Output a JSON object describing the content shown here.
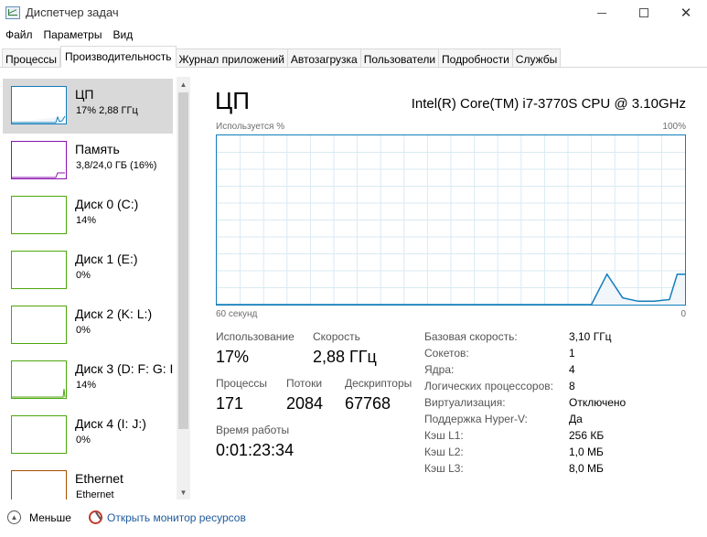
{
  "window": {
    "title": "Диспетчер задач",
    "close_glyph": "✕"
  },
  "menu": [
    "Файл",
    "Параметры",
    "Вид"
  ],
  "tabs": [
    {
      "label": "Процессы",
      "active": false
    },
    {
      "label": "Производительность",
      "active": true
    },
    {
      "label": "Журнал приложений",
      "active": false
    },
    {
      "label": "Автозагрузка",
      "active": false
    },
    {
      "label": "Пользователи",
      "active": false
    },
    {
      "label": "Подробности",
      "active": false
    },
    {
      "label": "Службы",
      "active": false
    }
  ],
  "sidebar": {
    "items": [
      {
        "title": "ЦП",
        "sub": "17% 2,88 ГГц",
        "color": "#117dbb",
        "selected": true,
        "icon": "cpu-graph-thumbnail"
      },
      {
        "title": "Память",
        "sub": "3,8/24,0 ГБ (16%)",
        "color": "#8b12ae",
        "selected": false,
        "icon": "memory-graph-thumbnail"
      },
      {
        "title": "Диск 0 (C:)",
        "sub": "14%",
        "color": "#4da60c",
        "selected": false,
        "icon": "disk-graph-thumbnail"
      },
      {
        "title": "Диск 1 (E:)",
        "sub": "0%",
        "color": "#4da60c",
        "selected": false,
        "icon": "disk-graph-thumbnail"
      },
      {
        "title": "Диск 2 (K: L:)",
        "sub": "0%",
        "color": "#4da60c",
        "selected": false,
        "icon": "disk-graph-thumbnail"
      },
      {
        "title": "Диск 3 (D: F: G: I",
        "sub": "14%",
        "color": "#4da60c",
        "selected": false,
        "icon": "disk-graph-thumbnail"
      },
      {
        "title": "Диск 4 (I: J:)",
        "sub": "0%",
        "color": "#4da60c",
        "selected": false,
        "icon": "disk-graph-thumbnail"
      },
      {
        "title": "Ethernet",
        "sub": "Ethernet",
        "color": "#a74f01",
        "selected": false,
        "icon": "network-graph-thumbnail"
      }
    ],
    "scroll_up": "▲",
    "scroll_down": "▼"
  },
  "main": {
    "title": "ЦП",
    "cpu_name": "Intel(R) Core(TM) i7-3770S CPU @ 3.10GHz",
    "graph_label_left": "Используется %",
    "graph_label_right": "100%",
    "axis_left": "60 секунд",
    "axis_right": "0",
    "graph_color": "#117dbb",
    "graph_fill": "#f1f6fa",
    "stats": {
      "usage_label": "Использование",
      "usage_value": "17%",
      "speed_label": "Скорость",
      "speed_value": "2,88 ГГц",
      "processes_label": "Процессы",
      "processes_value": "171",
      "threads_label": "Потоки",
      "threads_value": "2084",
      "handles_label": "Дескрипторы",
      "handles_value": "67768",
      "uptime_label": "Время работы",
      "uptime_value": "0:01:23:34"
    },
    "info": [
      {
        "label": "Базовая скорость:",
        "value": "3,10 ГГц"
      },
      {
        "label": "Сокетов:",
        "value": "1"
      },
      {
        "label": "Ядра:",
        "value": "4"
      },
      {
        "label": "Логических процессоров:",
        "value": "8"
      },
      {
        "label": "Виртуализация:",
        "value": "Отключено"
      },
      {
        "label": "Поддержка Hyper-V:",
        "value": "Да"
      },
      {
        "label": "Кэш L1:",
        "value": "256 КБ"
      },
      {
        "label": "Кэш L2:",
        "value": "1,0 МБ"
      },
      {
        "label": "Кэш L3:",
        "value": "8,0 МБ"
      }
    ]
  },
  "chart_data": {
    "type": "area",
    "ylim": [
      0,
      100
    ],
    "x": [
      60,
      12,
      10,
      8,
      6,
      4,
      2,
      1,
      0
    ],
    "values": [
      0,
      0,
      18,
      4,
      2,
      2,
      3,
      18,
      18
    ]
  },
  "bottom": {
    "less_label": "Меньше",
    "less_icon": "chevron-up-icon",
    "monitor_label": "Открыть монитор ресурсов"
  }
}
